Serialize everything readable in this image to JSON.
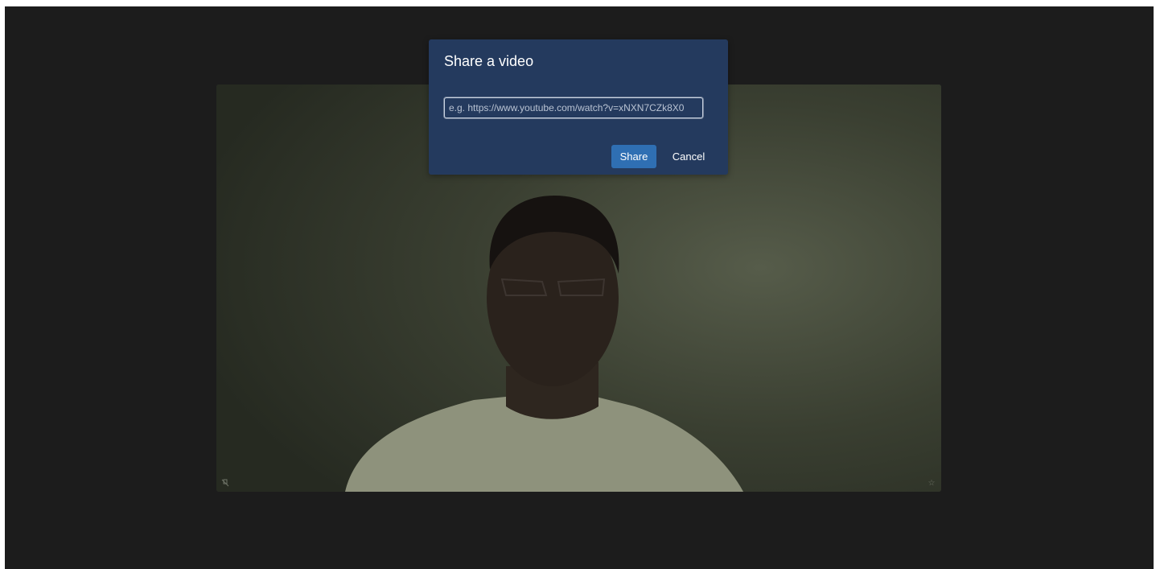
{
  "dialog": {
    "title": "Share a video",
    "url_placeholder": "e.g. https://www.youtube.com/watch?v=xNXN7CZk8X0",
    "url_value": "",
    "share_label": "Share",
    "cancel_label": "Cancel"
  },
  "video_tile": {
    "left_icon": "mic-muted-icon",
    "right_icon": "star-icon"
  },
  "colors": {
    "app_background": "#1c1c1c",
    "dialog_background": "#243a5e",
    "share_button": "#2f6fb3"
  }
}
